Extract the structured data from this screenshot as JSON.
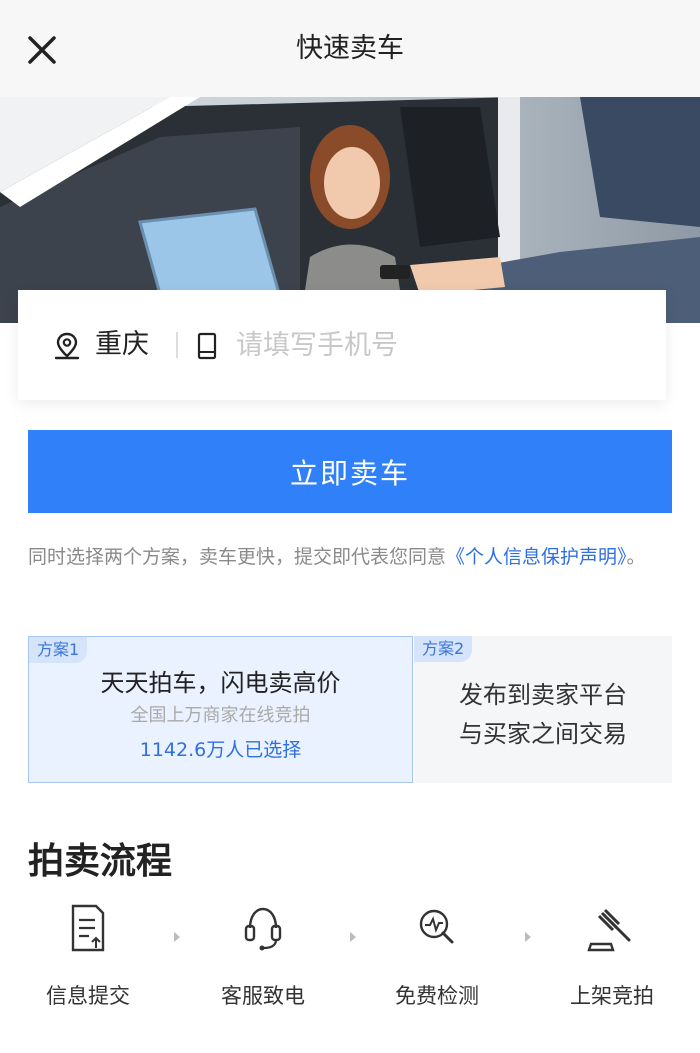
{
  "header": {
    "title": "快速卖车"
  },
  "form": {
    "city": "重庆",
    "phone_placeholder": "请填写手机号",
    "submit_label": "立即卖车"
  },
  "notice": {
    "text": "同时选择两个方案，卖车更快，提交即代表您同意",
    "link": "《个人信息保护声明》",
    "suffix": "。"
  },
  "plans": [
    {
      "tag": "方案1",
      "title": "天天拍车，闪电卖高价",
      "subtitle": "全国上万商家在线竞拍",
      "count": "1142.6万人已选择"
    },
    {
      "tag": "方案2",
      "lines": [
        "发布到卖家平台",
        "与买家之间交易"
      ]
    }
  ],
  "process": {
    "title": "拍卖流程",
    "steps": [
      {
        "label": "信息提交",
        "icon": "document-icon"
      },
      {
        "label": "客服致电",
        "icon": "headset-icon"
      },
      {
        "label": "免费检测",
        "icon": "inspect-icon"
      },
      {
        "label": "上架竞拍",
        "icon": "gavel-icon"
      }
    ]
  },
  "colors": {
    "accent": "#2f80f9",
    "link": "#2f6fe4",
    "plan_selected_bg": "#eaf2ff"
  }
}
